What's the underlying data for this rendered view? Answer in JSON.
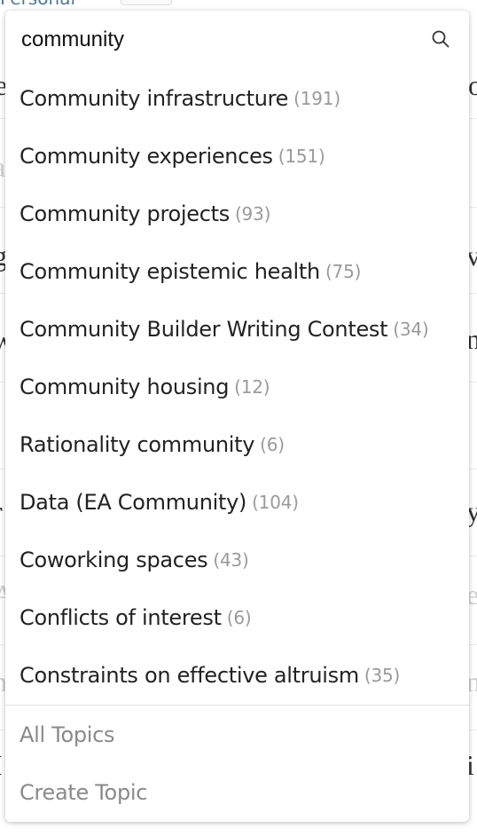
{
  "background": {
    "tab_label": "Personal",
    "plus_label": "+"
  },
  "search": {
    "value": "community"
  },
  "results": [
    {
      "name": "Community infrastructure",
      "count": "(191)"
    },
    {
      "name": "Community experiences",
      "count": "(151)"
    },
    {
      "name": "Community projects",
      "count": "(93)"
    },
    {
      "name": "Community epistemic health",
      "count": "(75)"
    },
    {
      "name": "Community Builder Writing Contest",
      "count": "(34)"
    },
    {
      "name": "Community housing",
      "count": "(12)"
    },
    {
      "name": "Rationality community",
      "count": "(6)"
    },
    {
      "name": "Data (EA Community)",
      "count": "(104)"
    },
    {
      "name": "Coworking spaces",
      "count": "(43)"
    },
    {
      "name": "Conflicts of interest",
      "count": "(6)"
    },
    {
      "name": "Constraints on effective altruism",
      "count": "(35)"
    }
  ],
  "footer": {
    "all_topics": "All Topics",
    "create_topic": "Create Topic"
  }
}
